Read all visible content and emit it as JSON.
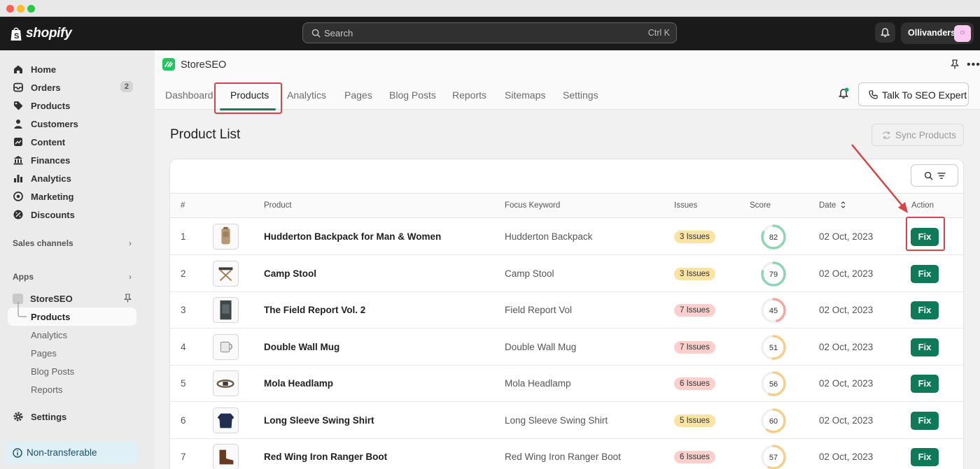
{
  "topbar": {
    "logo_text": "shopify",
    "search_placeholder": "Search",
    "search_shortcut": "Ctrl K",
    "store_name": "Ollivanders",
    "store_initials": "Ol"
  },
  "sidebar": {
    "items": [
      {
        "label": "Home",
        "icon": "home-icon"
      },
      {
        "label": "Orders",
        "icon": "orders-icon",
        "badge": "2"
      },
      {
        "label": "Products",
        "icon": "tag-icon"
      },
      {
        "label": "Customers",
        "icon": "person-icon"
      },
      {
        "label": "Content",
        "icon": "content-icon"
      },
      {
        "label": "Finances",
        "icon": "bank-icon"
      },
      {
        "label": "Analytics",
        "icon": "chart-icon"
      },
      {
        "label": "Marketing",
        "icon": "target-icon"
      },
      {
        "label": "Discounts",
        "icon": "discount-icon"
      }
    ],
    "sales_channels": "Sales channels",
    "apps": "Apps",
    "app_name": "StoreSEO",
    "app_sub_items": [
      "Products",
      "Analytics",
      "Pages",
      "Blog Posts",
      "Reports"
    ],
    "settings": "Settings",
    "non_transferable": "Non-transferable"
  },
  "app": {
    "name": "StoreSEO",
    "tabs": [
      "Dashboard",
      "Products",
      "Analytics",
      "Pages",
      "Blog Posts",
      "Reports",
      "Sitemaps",
      "Settings"
    ],
    "active_tab": "Products",
    "expert_button": "Talk To SEO Expert"
  },
  "page": {
    "title": "Product List",
    "sync_button": "Sync Products"
  },
  "table": {
    "headers": [
      "#",
      "Product",
      "Focus Keyword",
      "Issues",
      "Score",
      "Date",
      "Action"
    ],
    "rows": [
      {
        "num": "1",
        "name": "Hudderton Backpack for Man & Women",
        "keyword": "Hudderton Backpack",
        "issues": "3 Issues",
        "score": 82,
        "date": "02 Oct, 2023",
        "action": "Fix"
      },
      {
        "num": "2",
        "name": "Camp Stool",
        "keyword": "Camp Stool",
        "issues": "3 Issues",
        "score": 79,
        "date": "02 Oct, 2023",
        "action": "Fix"
      },
      {
        "num": "3",
        "name": "The Field Report Vol. 2",
        "keyword": "Field Report Vol",
        "issues": "7 Issues",
        "score": 45,
        "date": "02 Oct, 2023",
        "action": "Fix"
      },
      {
        "num": "4",
        "name": "Double Wall Mug",
        "keyword": "Double Wall Mug",
        "issues": "7 Issues",
        "score": 51,
        "date": "02 Oct, 2023",
        "action": "Fix"
      },
      {
        "num": "5",
        "name": "Mola Headlamp",
        "keyword": "Mola Headlamp",
        "issues": "6 Issues",
        "score": 56,
        "date": "02 Oct, 2023",
        "action": "Fix"
      },
      {
        "num": "6",
        "name": "Long Sleeve Swing Shirt",
        "keyword": "Long Sleeve Swing Shirt",
        "issues": "5 Issues",
        "score": 60,
        "date": "02 Oct, 2023",
        "action": "Fix"
      },
      {
        "num": "7",
        "name": "Red Wing Iron Ranger Boot",
        "keyword": "Red Wing Iron Ranger Boot",
        "issues": "6 Issues",
        "score": 57,
        "date": "02 Oct, 2023",
        "action": "Fix"
      }
    ]
  },
  "colors": {
    "accent": "#0e7a58",
    "highlight": "#d64545",
    "issues_yellow": "#fbe3a1",
    "issues_red": "#fbd0cc",
    "score_green": "#8fd4b3",
    "score_yellow": "#f4cf8a",
    "score_red": "#f2a79f"
  }
}
